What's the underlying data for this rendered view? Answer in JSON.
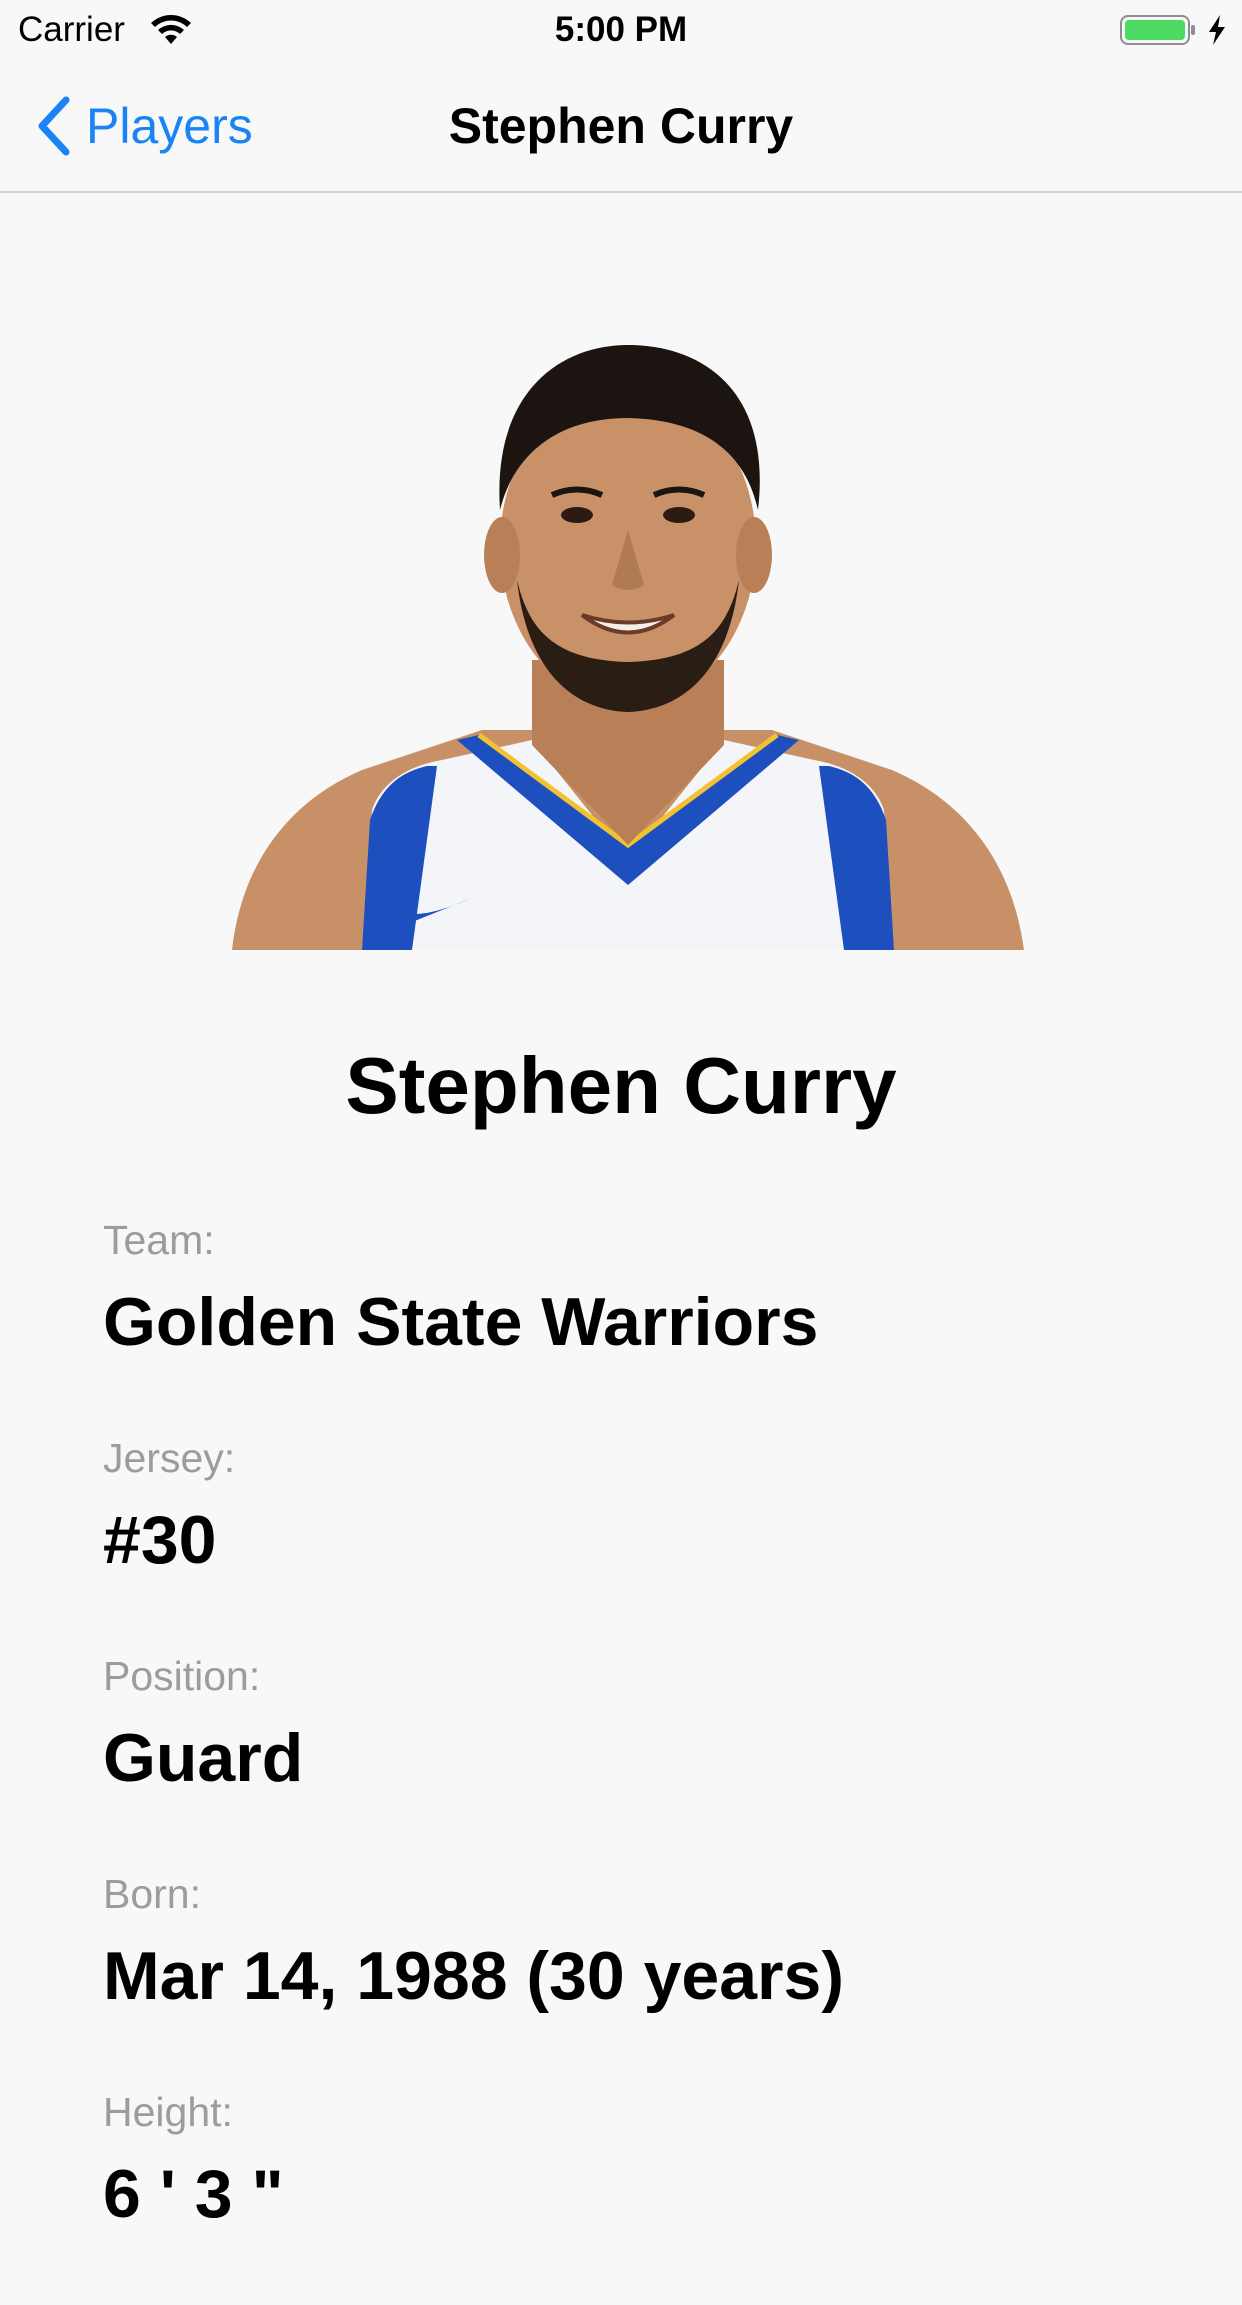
{
  "status_bar": {
    "carrier": "Carrier",
    "time": "5:00 PM",
    "battery_color": "#4cd964"
  },
  "nav": {
    "back_label": "Players",
    "title": "Stephen Curry",
    "accent_color": "#1a84f7"
  },
  "player": {
    "photo_icon": "player-headshot",
    "name": "Stephen Curry",
    "fields": [
      {
        "label": "Team:",
        "value": "Golden State Warriors"
      },
      {
        "label": "Jersey:",
        "value": "#30"
      },
      {
        "label": "Position:",
        "value": "Guard"
      },
      {
        "label": "Born:",
        "value": "Mar 14, 1988 (30 years)"
      },
      {
        "label": "Height:",
        "value": "6 ' 3 \""
      }
    ]
  }
}
